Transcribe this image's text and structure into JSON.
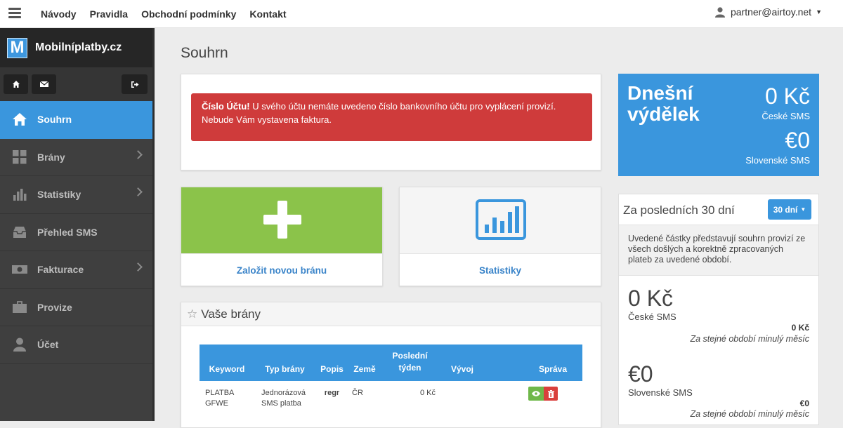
{
  "topnav": {
    "items": [
      "Návody",
      "Pravidla",
      "Obchodní podmínky",
      "Kontakt"
    ],
    "user": "partner@airtoy.net"
  },
  "sidebar": {
    "logo_letter": "M",
    "brand": "Mobilníplatby.cz",
    "items": [
      {
        "label": "Souhrn",
        "icon": "home-icon",
        "active": true
      },
      {
        "label": "Brány",
        "icon": "grid-icon"
      },
      {
        "label": "Statistiky",
        "icon": "bar-chart-icon"
      },
      {
        "label": "Přehled SMS",
        "icon": "inbox-icon"
      },
      {
        "label": "Fakturace",
        "icon": "money-icon"
      },
      {
        "label": "Provize",
        "icon": "briefcase-icon"
      },
      {
        "label": "Účet",
        "icon": "user-icon"
      }
    ]
  },
  "main": {
    "title": "Souhrn",
    "alert": {
      "strong": "Číslo Účtu!",
      "text": " U svého účtu nemáte uvedeno číslo bankovního účtu pro vyplácení provizí. Nebude Vám vystavena faktura."
    },
    "tiles": {
      "new_gate": "Založit novou bránu",
      "stats": "Statistiky"
    },
    "gates": {
      "title": "Vaše brány",
      "headers": {
        "keyword": "Keyword",
        "type": "Typ brány",
        "desc": "Popis",
        "country": "Země",
        "lastweek_1": "Poslední",
        "lastweek_2": "týden",
        "trend": "Vývoj",
        "manage": "Správa"
      },
      "row": {
        "keyword_1": "PLATBA",
        "keyword_2": "GFWE",
        "type_1": "Jednorázová",
        "type_2": "SMS platba",
        "desc": "regr",
        "country": "ČR",
        "lastweek": "0 Kč"
      }
    }
  },
  "earnings": {
    "title_1": "Dnešní",
    "title_2": "výdělek",
    "cz_amount": "0 Kč",
    "cz_label": "České SMS",
    "sk_amount": "€0",
    "sk_label": "Slovenské SMS"
  },
  "last30": {
    "title": "Za posledních 30 dní",
    "button": "30 dní",
    "note": "Uvedené částky představují souhrn provizí ze všech došlých a korektně zpracovaných plateb za uvedené období.",
    "cz_amount": "0 Kč",
    "cz_label": "České SMS",
    "cz_prev": "0 Kč",
    "prev_label": "Za stejné období minulý měsíc",
    "sk_amount": "€0",
    "sk_label": "Slovenské SMS",
    "sk_prev": "€0"
  },
  "colors": {
    "accent": "#3a96dd",
    "danger": "#cf3b3b",
    "success": "#8bc34a"
  }
}
